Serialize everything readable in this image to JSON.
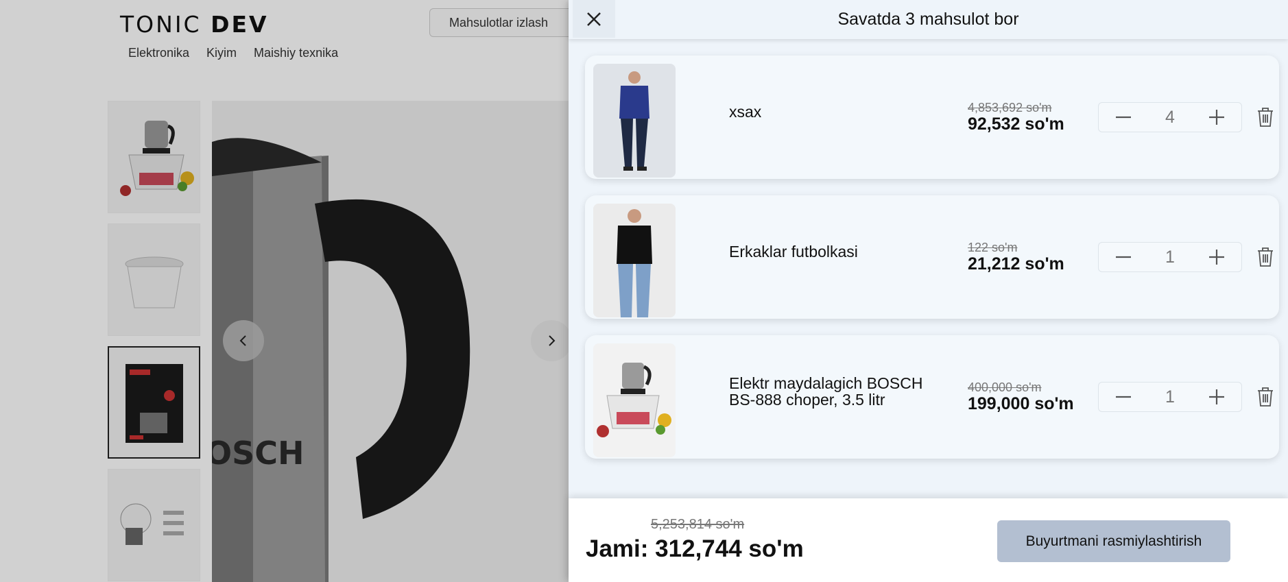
{
  "page": {
    "logo": {
      "part1": "TONIC ",
      "part2": "DEV"
    },
    "search_label": "Mahsulotlar izlash",
    "nav": [
      "Elektronika",
      "Kiyim",
      "Maishiy texnika"
    ],
    "product_image_text": "OSCH",
    "box_text": "BOSCH"
  },
  "cart": {
    "title": "Savatda 3 mahsulot bor",
    "items": [
      {
        "name": "xsax",
        "old_price": "4,853,692 so'm",
        "price": "92,532 so'm",
        "quantity": "4"
      },
      {
        "name": "Erkaklar futbolkasi",
        "old_price": "122 so'm",
        "price": "21,212 so'm",
        "quantity": "1"
      },
      {
        "name": "Elektr maydalagich BOSCH BS-888 choper, 3.5 litr",
        "old_price": "400,000 so'm",
        "price": "199,000 so'm",
        "quantity": "1"
      }
    ],
    "footer": {
      "old_total": "5,253,814 so'm",
      "total_label": "Jami:",
      "total": "312,744 so'm",
      "checkout_label": "Buyurtmani rasmiylashtirish"
    }
  },
  "colors": {
    "drawer_bg": "#eef4fa",
    "card_bg": "#f3f8fc",
    "checkout_button": "#b3bfd1",
    "strike_price": "#777777"
  }
}
